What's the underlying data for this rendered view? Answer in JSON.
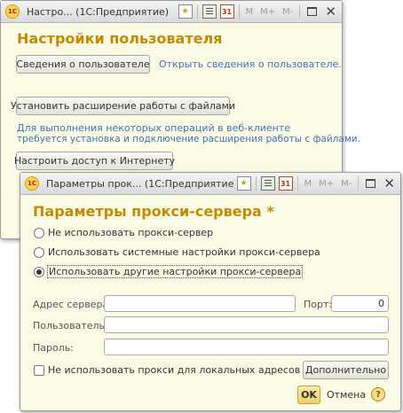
{
  "back_window": {
    "title": "Настро... (1С:Предприятие)",
    "toolbar": {
      "m": "M",
      "m_plus": "M+",
      "m_minus": "M-",
      "cal_day": "31"
    },
    "heading": "Настройки пользователя",
    "user_info_button": "Сведения о пользователе",
    "user_info_link": "Открыть сведения о пользователе.",
    "install_ext_button": "Установить расширение работы с файлами",
    "info_text_1": "Для выполнения некоторых операций в веб-клиенте",
    "info_text_2": "требуется установка и подключение расширения работы с файлами.",
    "internet_button": "Настроить доступ к Интернету"
  },
  "proxy_window": {
    "title": "Параметры прок... (1С:Предприятие)",
    "toolbar": {
      "m": "M",
      "m_plus": "M+",
      "m_minus": "M-",
      "cal_day": "31"
    },
    "heading": "Параметры прокси-сервера *",
    "options": [
      {
        "label": "Не использовать прокси-сервер",
        "selected": false
      },
      {
        "label": "Использовать системные настройки прокси-сервера",
        "selected": false
      },
      {
        "label": "Использовать другие настройки прокси-сервера",
        "selected": true
      }
    ],
    "server_label": "Адрес сервера:",
    "server_value": "",
    "port_label": "Порт:",
    "port_value": "0",
    "user_label": "Пользователь:",
    "user_value": "",
    "password_label": "Пароль:",
    "password_value": "",
    "bypass_local_label": "Не использовать прокси для локальных адресов",
    "bypass_local_checked": false,
    "additional_button": "Дополнительно",
    "ok_button": "OK",
    "cancel_button": "Отмена",
    "help_glyph": "?"
  },
  "colors": {
    "accent_heading": "#c58a00",
    "link": "#3f73b5",
    "window_bg": "#fbfbe6"
  },
  "icons": [
    "1c-logo-icon",
    "favorite-icon",
    "calculator-icon",
    "calendar-icon",
    "maximize-icon",
    "close-icon",
    "help-icon"
  ]
}
